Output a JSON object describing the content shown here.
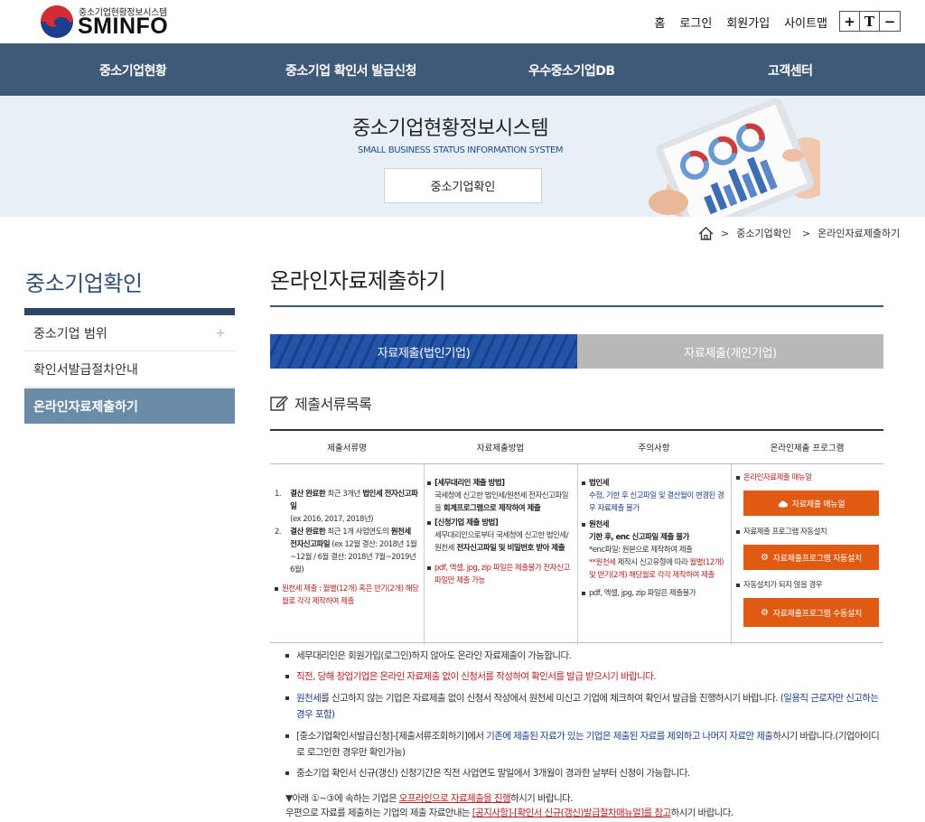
{
  "header": {
    "logo_sub": "중소기업현황정보시스템",
    "logo_main": "SMINFO",
    "util_links": [
      "홈",
      "로그인",
      "회원가입",
      "사이트맵"
    ],
    "font_controls": [
      "+",
      "T",
      "−"
    ]
  },
  "gnb": [
    "중소기업현황",
    "중소기업 확인서 발급신청",
    "우수중소기업DB",
    "고객센터"
  ],
  "banner": {
    "title": "중소기업현황정보시스템",
    "subtitle": "SMALL BUSINESS STATUS INFORMATION SYSTEM",
    "button": "중소기업확인"
  },
  "breadcrumb": [
    "중소기업확인",
    "온라인자료제출하기"
  ],
  "sidebar": {
    "title": "중소기업확인",
    "items": [
      {
        "label": "중소기업 범위",
        "expand": "+"
      },
      {
        "label": "확인서발급절차안내"
      },
      {
        "label": "온라인자료제출하기"
      }
    ]
  },
  "content": {
    "title": "온라인자료제출하기",
    "tabs": [
      "자료제출(법인기업)",
      "자료제출(개인기업)"
    ],
    "section_title": "제출서류목록"
  },
  "table": {
    "headers": [
      "제출서류명",
      "자료제출방법",
      "주의사항",
      "온라인제출 프로그램"
    ],
    "col1": {
      "n1": "1.",
      "i1a": "결산 완료한",
      "i1b": " 최근 3개년",
      "i1c": " 법인세 전자신고파일",
      "i1d": "(ex 2016, 2017, 2018년)",
      "n2": "2.",
      "i2a": "결산 완료한",
      "i2b": " 최근 1개 사업연도의",
      "i2c": " 원천세 전자신고파일",
      "i2d": " (ex 12월 결산: 2018년 1월~12월 / 6월 결산: 2018년 7월~2019년 6월)",
      "warn": "원천세 제출 : 월별(12개) 혹은 반기(2개) 해당월로 각각 제작하여 제출"
    },
    "col2": {
      "h1": "[세무대리인 제출 방법]",
      "t1a": "국세청에 신고한 법인세/원천세 전자신고파일을",
      "t1b": " 회계프로그램으로 제작하여 제출",
      "h2": "[신청기업 제출 방법]",
      "t2a": "세무대리인으로부터 국세청에 신고한 법인세/원천세",
      "t2b": " 전자신고파일 및 비밀번호 받아 제출",
      "warn": "pdf, 엑셀, jpg, zip 파일은 제출불가 전자신고파일만 제출 가능"
    },
    "col3": {
      "h1": "법인세",
      "t1": "수정, 기한 후 신고파일 및 결산월이 변경된 경우 자료제출 불가",
      "h2": "원천세",
      "t2": "기한 후, enc 신고파일 제출 불가",
      "t3": "*enc파일: 원본으로 제작하여 제출",
      "t4a": "**원천세",
      "t4b": " 제작시 신고유형에 따라",
      "t4c": " 월별(12개) 및 반기(2개) 해당월로 각각 제작하여 제출",
      "t5": "pdf, 엑셀, jpg, zip 파일은 제출불가"
    },
    "col4": {
      "l1": "온라인자료제출 매뉴얼",
      "b1": "자료제출 매뉴얼",
      "l2": "자료제출 프로그램 자동설치",
      "b2": "자료제출프로그램 자동설치",
      "l3": "자동설치가 되지 않을 경우",
      "b3": "자료제출프로그램 수동설치"
    }
  },
  "notes": [
    {
      "text": "세무대리인은 회원가입(로그인)하지 않아도 온라인 자료제출이 가능합니다."
    },
    {
      "text": "직전, 당해 창업기업은 온라인 자료제출 없이 신청서를 작성하여 확인서를 발급 받으시기 바랍니다."
    },
    {
      "a": "원천세",
      "b": "를 신고하지 않는 기업은 자료제출 없이 신청서 작성에서 원천세 미신고 기업에 체크하여 확인서 발급을 진행하시기 바랍니다.",
      "c": " (일용직 근로자만 신고하는 경우 포함)"
    },
    {
      "a": "[중소기업확인서발급신청]-[제출서류조회하기]에서 ",
      "b": "기존에 제출된 자료가 있는 기업은 제출된 자료를 제외하고 나머지 자료만 제출",
      "c": "하시기 바랍니다.(기업아이디로 로그인한 경우만 확인가능)"
    },
    {
      "text": "중소기업 확인서 신규(갱신) 신청기간은 직전 사업연도 말일에서 3개월이 경과한 날부터 신청이 가능합니다."
    }
  ],
  "tail": {
    "l1a": "▼아래 ①~③에 속하는 기업은 ",
    "l1b": "오프라인으로 자료제출을 진행",
    "l1c": "하시기 바랍니다.",
    "l2a": "우편으로 자료를 제출하는 기업의 제출 자료안내는 ",
    "l2b": "[공지사항]-[확인서 신규(갱신)발급절차매뉴얼]를 참고",
    "l2c": "하시기 바랍니다."
  },
  "colors": {
    "gnb": "#3f5a78",
    "accent": "#e05a12",
    "tab_active": "#2354a8",
    "sidebar_active": "#6a8ca9"
  }
}
